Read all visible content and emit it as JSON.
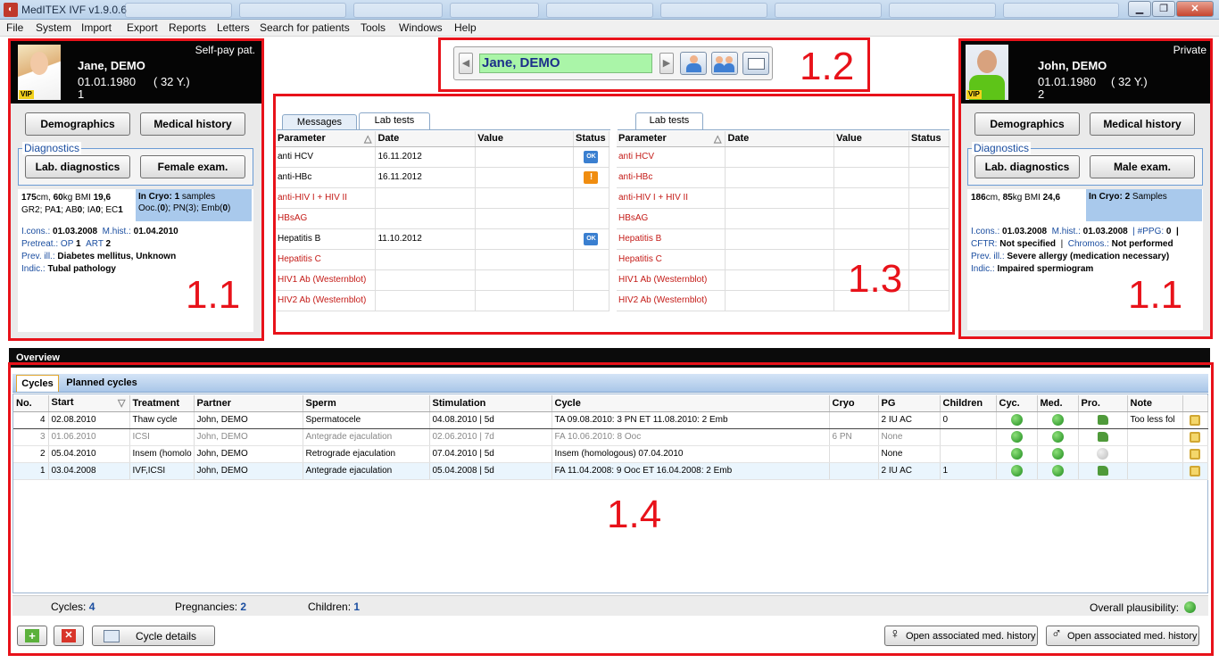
{
  "window": {
    "title": "MedITEX IVF v1.9.0.6",
    "controls": {
      "minimize": "▁",
      "maximize": "❐",
      "close": "✕"
    }
  },
  "menu": [
    "File",
    "System",
    "Import",
    "Export",
    "Reports",
    "Letters",
    "Search for patients",
    "Tools",
    "Windows",
    "Help"
  ],
  "annotations": {
    "left": "1.1",
    "nav": "1.2",
    "lab": "1.3",
    "right": "1.1",
    "overview": "1.4"
  },
  "female": {
    "payment": "Self-pay pat.",
    "name": "Jane, DEMO",
    "dob": "01.01.1980",
    "age": "( 32 Y.)",
    "index": "1",
    "vip": "VIP",
    "btn_demographics": "Demographics",
    "btn_medical_history": "Medical history",
    "diagnostics_legend": "Diagnostics",
    "btn_lab": "Lab. diagnostics",
    "btn_exam": "Female exam.",
    "height": "175",
    "height_unit": "cm, ",
    "weight": "60",
    "weight_unit": "kg BMI ",
    "bmi": "19,6",
    "gr_line_parts": [
      "GR2",
      "; PA",
      "1",
      "; AB",
      "0",
      "; IA",
      "0",
      "; EC",
      "1"
    ],
    "cryo_label": "In Cryo:",
    "cryo_count": "1",
    "cryo_unit": " samples",
    "cryo_line": [
      "Ooc.(",
      "0",
      "); PN(3); Emb(",
      "0",
      ")"
    ],
    "icons_label": "I.cons.:",
    "icons_val": "01.03.2008",
    "mhist_label": "M.hist.:",
    "mhist_val": "01.04.2010",
    "pretreat_label": "Pretreat.:",
    "op_label": "OP",
    "op_val": "1",
    "art_label": "ART",
    "art_val": "2",
    "prev_label": "Prev. ill.:",
    "prev_val": "Diabetes mellitus, Unknown",
    "indic_label": "Indic.:",
    "indic_val": "Tubal pathology"
  },
  "male": {
    "payment": "Private",
    "name": "John, DEMO",
    "dob": "01.01.1980",
    "age": "( 32 Y.)",
    "index": "2",
    "vip": "VIP",
    "btn_demographics": "Demographics",
    "btn_medical_history": "Medical history",
    "diagnostics_legend": "Diagnostics",
    "btn_lab": "Lab. diagnostics",
    "btn_exam": "Male exam.",
    "height": "186",
    "height_unit": "cm, ",
    "weight": "85",
    "weight_unit": "kg BMI ",
    "bmi": "24,6",
    "cryo_label": "In Cryo:",
    "cryo_count": "2",
    "cryo_unit": " Samples",
    "icons_label": "I.cons.:",
    "icons_val": "01.03.2008",
    "mhist_label": "M.hist.:",
    "mhist_val": "01.03.2008",
    "ppg_label": "| #PPG:",
    "ppg_val": "0",
    "ppg_end": "|",
    "cftr_label": "CFTR:",
    "cftr_val": "Not specified",
    "chromos_label": "Chromos.:",
    "chromos_val": "Not performed",
    "prev_label": "Prev. ill.:",
    "prev_val": "Severe allergy (medication necessary)",
    "indic_label": "Indic.:",
    "indic_val": "Impaired spermiogram"
  },
  "nav": {
    "prev": "◀",
    "next": "▶",
    "name": "Jane, DEMO"
  },
  "lab_left": {
    "tabs": [
      "Messages",
      "Lab tests"
    ],
    "headers": [
      "Parameter",
      "Date",
      "Value",
      "Status"
    ],
    "rows": [
      {
        "param": "anti HCV",
        "date": "16.11.2012",
        "value": "",
        "status": "OK",
        "red": false
      },
      {
        "param": "anti-HBc",
        "date": "16.11.2012",
        "value": "",
        "status": "!",
        "red": false
      },
      {
        "param": "anti-HIV I + HIV II",
        "date": "",
        "value": "",
        "status": "",
        "red": true
      },
      {
        "param": "HBsAG",
        "date": "",
        "value": "",
        "status": "",
        "red": true
      },
      {
        "param": "Hepatitis B",
        "date": "11.10.2012",
        "value": "",
        "status": "OK",
        "red": false
      },
      {
        "param": "Hepatitis C",
        "date": "",
        "value": "",
        "status": "",
        "red": true
      },
      {
        "param": "HIV1 Ab (Westernblot)",
        "date": "",
        "value": "",
        "status": "",
        "red": true
      },
      {
        "param": "HIV2 Ab (Westernblot)",
        "date": "",
        "value": "",
        "status": "",
        "red": true
      }
    ]
  },
  "lab_right": {
    "tab": "Lab tests",
    "headers": [
      "Parameter",
      "Date",
      "Value",
      "Status"
    ],
    "rows": [
      "anti HCV",
      "anti-HBc",
      "anti-HIV I + HIV II",
      "HBsAG",
      "Hepatitis B",
      "Hepatitis C",
      "HIV1 Ab (Westernblot)",
      "HIV2 Ab (Westernblot)"
    ]
  },
  "overview": {
    "title": "Overview",
    "tabs": [
      "Cycles",
      "Planned cycles"
    ],
    "headers": [
      "No.",
      "Start",
      "Treatment",
      "Partner",
      "Sperm",
      "Stimulation",
      "Cycle",
      "Cryo",
      "PG",
      "Children",
      "Cyc.",
      "Med.",
      "Pro.",
      "Note",
      ""
    ],
    "rows": [
      {
        "no": "4",
        "start": "02.08.2010",
        "treatment": "Thaw cycle",
        "partner": "John, DEMO",
        "sperm": "Spermatocele",
        "stim": "04.08.2010 | 5d",
        "cycle": "TA 09.08.2010: 3 PN     ET 11.08.2010: 2 Emb",
        "cryo": "",
        "pg": "2 IU AC",
        "children": "0",
        "pro": "thumb",
        "note": "Too less fol"
      },
      {
        "no": "3",
        "start": "01.06.2010",
        "treatment": "ICSI",
        "partner": "John, DEMO",
        "sperm": "Antegrade ejaculation",
        "stim": "02.06.2010 | 7d",
        "cycle": "FA 10.06.2010: 8 Ooc",
        "cryo": "6 PN",
        "pg": "None",
        "children": "",
        "pro": "thumb",
        "note": ""
      },
      {
        "no": "2",
        "start": "05.04.2010",
        "treatment": "Insem (homolo",
        "partner": "John, DEMO",
        "sperm": "Retrograde ejaculation",
        "stim": "07.04.2010 | 5d",
        "cycle": "Insem (homologous) 07.04.2010",
        "cryo": "",
        "pg": "None",
        "children": "",
        "pro": "grey",
        "note": ""
      },
      {
        "no": "1",
        "start": "03.04.2008",
        "treatment": "IVF,ICSI",
        "partner": "John, DEMO",
        "sperm": "Antegrade ejaculation",
        "stim": "05.04.2008 | 5d",
        "cycle": "FA 11.04.2008: 9 Ooc     ET 16.04.2008: 2 Emb",
        "cryo": "",
        "pg": "2 IU AC",
        "children": "1",
        "pro": "thumb",
        "note": ""
      }
    ],
    "summary": {
      "cycles_label": "Cycles:",
      "cycles": "4",
      "preg_label": "Pregnancies:",
      "preg": "2",
      "children_label": "Children:",
      "children": "1",
      "plaus_label": "Overall plausibility:"
    },
    "btn_cycle_details": "Cycle details",
    "btn_open_female": "Open associated med. history",
    "btn_open_male": "Open associated med. history",
    "female_symbol": "♀",
    "male_symbol": "♂"
  },
  "colors": {
    "annotation_red": "#e8121a",
    "lab_missing_red": "#c41b17",
    "nav_name_bg": "#aaf5a8",
    "cryo_bg": "#a9c9ec"
  }
}
